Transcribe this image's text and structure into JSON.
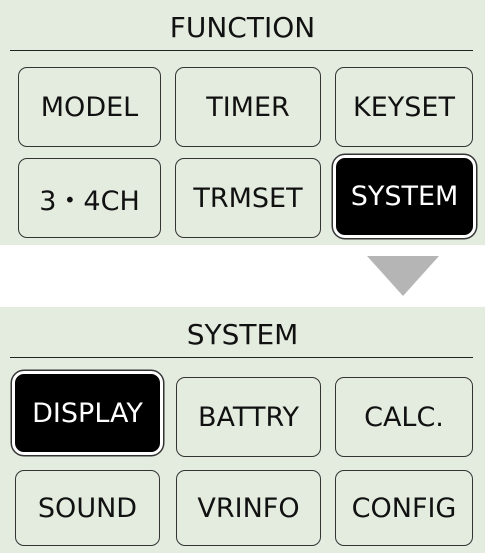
{
  "function_menu": {
    "title": "FUNCTION",
    "buttons": [
      {
        "label": "MODEL"
      },
      {
        "label": "TIMER"
      },
      {
        "label": "KEYSET"
      },
      {
        "label": "3・4CH"
      },
      {
        "label": "TRMSET"
      },
      {
        "label": "SYSTEM",
        "selected": true
      }
    ]
  },
  "system_menu": {
    "title": "SYSTEM",
    "buttons": [
      {
        "label": "DISPLAY",
        "selected": true
      },
      {
        "label": "BATTRY"
      },
      {
        "label": "CALC."
      },
      {
        "label": "SOUND"
      },
      {
        "label": "VRINFO"
      },
      {
        "label": "CONFIG"
      }
    ]
  },
  "transition_arrow": {
    "icon": "down-triangle-icon",
    "color": "#b5b5b5"
  },
  "colors": {
    "panel": "#e3ecdf",
    "selected_bg": "#000000",
    "selected_text": "#ffffff"
  }
}
